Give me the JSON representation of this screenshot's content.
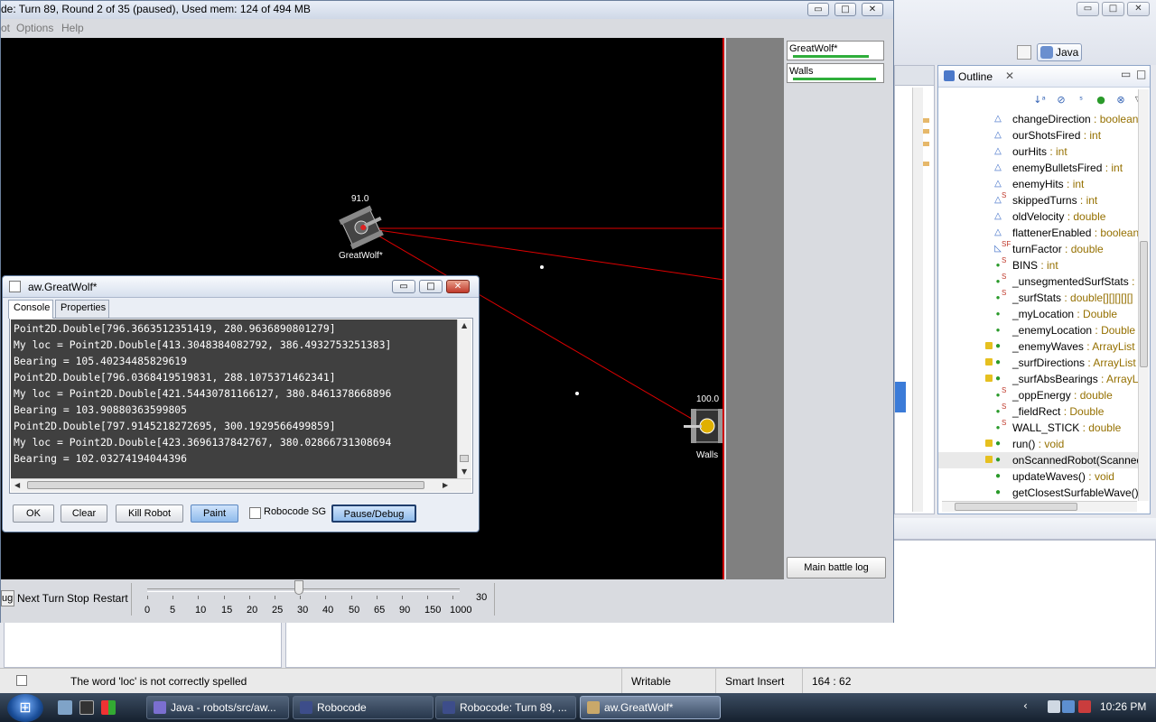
{
  "robocode_window": {
    "title": "de: Turn 89, Round 2 of 35 (paused), Used mem: 124 of 494 MB",
    "menu": [
      "ot",
      "Options",
      "Help"
    ],
    "window_buttons": [
      "▭",
      "□",
      "✕"
    ]
  },
  "arena": {
    "robots": [
      {
        "name": "GreatWolf*",
        "energy": "91.0"
      },
      {
        "name": "Walls",
        "energy": "100.0"
      }
    ]
  },
  "robot_list": {
    "entries": [
      {
        "name": "GreatWolf*",
        "energy_fraction": 0.91
      },
      {
        "name": "Walls",
        "energy_fraction": 1.0
      }
    ],
    "main_battle_log": "Main battle log"
  },
  "controls": {
    "debug": "ug",
    "next_turn": "Next Turn",
    "stop": "Stop",
    "restart": "Restart",
    "speed_ticks": [
      "0",
      "5",
      "10",
      "15",
      "20",
      "25",
      "30",
      "40",
      "50",
      "65",
      "90",
      "150",
      "1000"
    ],
    "speed_value": "30"
  },
  "dialog": {
    "title": "aw.GreatWolf*",
    "tabs": [
      "Console",
      "Properties"
    ],
    "console_lines": [
      "Point2D.Double[796.3663512351419, 280.9636890801279]",
      "My loc = Point2D.Double[413.3048384082792, 386.4932753251383]",
      "Bearing = 105.40234485829619",
      "Point2D.Double[796.0368419519831, 288.1075371462341]",
      "My loc = Point2D.Double[421.54430781166127, 380.8461378668896",
      "Bearing = 103.90880363599805",
      "Point2D.Double[797.9145218272695, 300.1929566499859]",
      "My loc = Point2D.Double[423.3696137842767, 380.02866731308694",
      "Bearing = 102.03274194044396"
    ],
    "buttons": {
      "ok": "OK",
      "clear": "Clear",
      "kill": "Kill Robot",
      "paint": "Paint",
      "robocode_sg": "Robocode SG",
      "pause": "Pause/Debug"
    }
  },
  "eclipse": {
    "perspective": "Java",
    "outline": {
      "title": "Outline",
      "items": [
        {
          "name": "changeDirection",
          "type": " : boolean",
          "icon": "field-default"
        },
        {
          "name": "ourShotsFired",
          "type": " : int",
          "icon": "field-default"
        },
        {
          "name": "ourHits",
          "type": " : int",
          "icon": "field-default"
        },
        {
          "name": "enemyBulletsFired",
          "type": " : int",
          "icon": "field-default"
        },
        {
          "name": "enemyHits",
          "type": " : int",
          "icon": "field-default"
        },
        {
          "name": "skippedTurns",
          "type": " : int",
          "icon": "field-static"
        },
        {
          "name": "oldVelocity",
          "type": " : double",
          "icon": "field-default"
        },
        {
          "name": "flattenerEnabled",
          "type": " : boolean",
          "icon": "field-default"
        },
        {
          "name": "turnFactor",
          "type": " : double",
          "icon": "field-static-final"
        },
        {
          "name": "BINS",
          "type": " : int",
          "icon": "field-public-static"
        },
        {
          "name": "_unsegmentedSurfStats",
          "type": " : d",
          "icon": "field-public-static"
        },
        {
          "name": "_surfStats",
          "type": " : double[][][][][]",
          "icon": "field-public-static"
        },
        {
          "name": "_myLocation",
          "type": " : Double",
          "icon": "field-public"
        },
        {
          "name": "_enemyLocation",
          "type": " : Double",
          "icon": "field-public"
        },
        {
          "name": "_enemyWaves",
          "type": " : ArrayList",
          "icon": "field-public-warning"
        },
        {
          "name": "_surfDirections",
          "type": " : ArrayList",
          "icon": "field-public-warning"
        },
        {
          "name": "_surfAbsBearings",
          "type": " : ArrayLi",
          "icon": "field-public-warning"
        },
        {
          "name": "_oppEnergy",
          "type": " : double",
          "icon": "field-public-static"
        },
        {
          "name": "_fieldRect",
          "type": " : Double",
          "icon": "field-public-static"
        },
        {
          "name": "WALL_STICK",
          "type": " : double",
          "icon": "field-public-static"
        },
        {
          "name": "run()",
          "type": " : void",
          "icon": "method-override"
        },
        {
          "name": "onScannedRobot(Scanned",
          "type": "",
          "icon": "method-override"
        },
        {
          "name": "updateWaves()",
          "type": " : void",
          "icon": "method-public"
        },
        {
          "name": "getClosestSurfableWave()",
          "type": "",
          "icon": "method-public"
        }
      ]
    },
    "status": {
      "message": "The word 'loc' is not correctly spelled",
      "writable": "Writable",
      "insert_mode": "Smart Insert",
      "position": "164 : 62"
    }
  },
  "taskbar": {
    "items": [
      {
        "label": "Java - robots/src/aw...",
        "active": false
      },
      {
        "label": "Robocode",
        "active": false
      },
      {
        "label": "Robocode: Turn 89, ...",
        "active": false
      },
      {
        "label": "aw.GreatWolf*",
        "active": true
      }
    ],
    "clock": "10:26 PM"
  }
}
